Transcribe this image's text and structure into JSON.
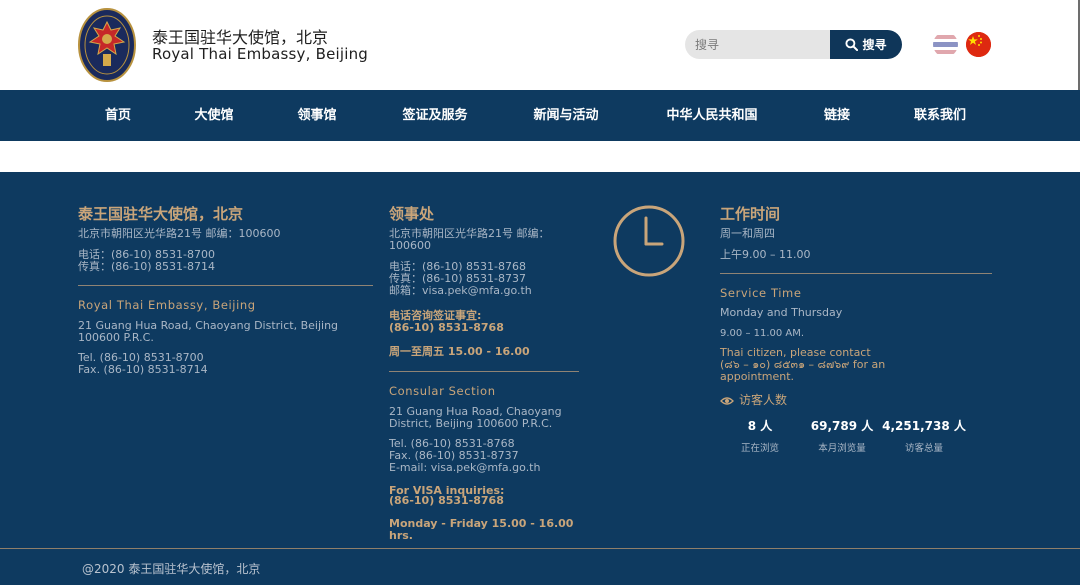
{
  "header": {
    "title_cn": "泰王国驻华大使馆，北京",
    "title_en": "Royal Thai Embassy, Beijing",
    "logo_icon": "thai-garuda-emblem-icon",
    "search": {
      "placeholder": "搜寻",
      "button_label": "搜寻",
      "button_icon": "search-icon"
    },
    "flags": [
      {
        "name": "thai-flag-icon"
      },
      {
        "name": "china-flag-icon"
      }
    ]
  },
  "nav": {
    "items": [
      {
        "label": "首页"
      },
      {
        "label": "大使馆"
      },
      {
        "label": "领事馆"
      },
      {
        "label": "签证及服务"
      },
      {
        "label": "新闻与活动"
      },
      {
        "label": "中华人民共和国"
      },
      {
        "label": "链接"
      },
      {
        "label": "联系我们"
      }
    ]
  },
  "footer": {
    "embassy": {
      "title_cn": "泰王国驻华大使馆，北京",
      "address_cn": "北京市朝阳区光华路21号 邮编：100600",
      "phone_cn": "电话：(86-10) 8531-8700",
      "fax_cn": "传真：(86-10) 8531-8714",
      "title_en": "Royal Thai Embassy, Beijing",
      "address_en_1": "21 Guang Hua Road, Chaoyang District, Beijing",
      "address_en_2": "100600 P.R.C.",
      "phone_en": "Tel. (86-10) 8531-8700",
      "fax_en": "Fax. (86-10) 8531-8714"
    },
    "consulate": {
      "title_cn": "领事处",
      "address_cn_1": "北京市朝阳区光华路21号 邮编：",
      "address_cn_2": "100600",
      "phone_cn": "电话：(86-10) 8531-8768",
      "fax_cn": "传真：(86-10) 8531-8737",
      "email_cn": "邮箱：visa.pek@mfa.go.th",
      "visa_inquiry_cn_1": "电话咨询签证事宜:",
      "visa_inquiry_cn_2": "(86-10) 8531-8768",
      "visa_hours_cn": "周一至周五 15.00 - 16.00",
      "title_en": "Consular Section",
      "address_en_1": "21 Guang Hua Road, Chaoyang",
      "address_en_2": "District, Beijing 100600 P.R.C.",
      "phone_en": "Tel. (86-10) 8531-8768",
      "fax_en": "Fax. (86-10) 8531-8737",
      "email_en": "E-mail: visa.pek@mfa.go.th",
      "visa_inquiry_en_1": "For VISA inquiries:",
      "visa_inquiry_en_2": "(86-10) 8531-8768",
      "visa_hours_en_1": "Monday - Friday 15.00 - 16.00",
      "visa_hours_en_2": "hrs."
    },
    "hours": {
      "clock_icon": "clock-icon",
      "title_cn": "工作时间",
      "days_cn": "周一和周四",
      "time_cn": "上午9.00 – 11.00",
      "title_en": "Service Time",
      "days_en": "Monday and Thursday",
      "time_en": "9.00 – 11.00 AM.",
      "thai_notice_1": "Thai citizen, please contact",
      "thai_notice_2": "(๘๖ – ๑๐) ๘๕๓๑ – ๘๗๖๙ for an",
      "thai_notice_3": "appointment.",
      "visitors_icon": "eye-icon",
      "visitors_title": "访客人数",
      "stats": [
        {
          "value": "8 人",
          "label": "正在浏览"
        },
        {
          "value": "69,789 人",
          "label": "本月浏览量"
        },
        {
          "value": "4,251,738 人",
          "label": "访客总量"
        }
      ]
    },
    "copyright": "@2020 泰王国驻华大使馆，北京"
  },
  "colors": {
    "navy": "#0e3a60",
    "gold": "#c9a57a",
    "search_button": "#0f3659"
  }
}
